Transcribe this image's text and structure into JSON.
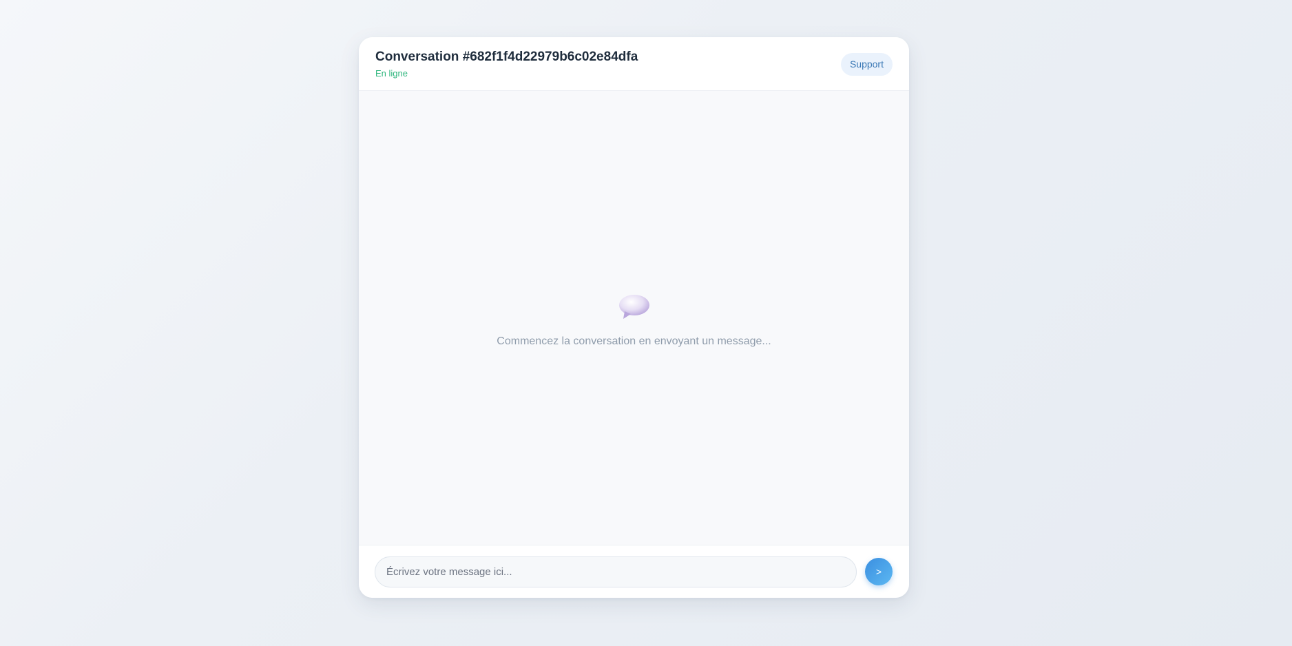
{
  "header": {
    "title": "Conversation #682f1f4d22979b6c02e84dfa",
    "status": "En ligne",
    "status_color": "#2eb67d",
    "support_label": "Support"
  },
  "empty_state": {
    "icon": "speech-bubble-icon",
    "text": "Commencez la conversation en envoyant un message..."
  },
  "composer": {
    "placeholder": "Écrivez votre message ici...",
    "value": "",
    "send_label": ">"
  },
  "colors": {
    "accent": "#3b8fe0",
    "title": "#1f2d3d",
    "muted_text": "#8f9cab"
  }
}
